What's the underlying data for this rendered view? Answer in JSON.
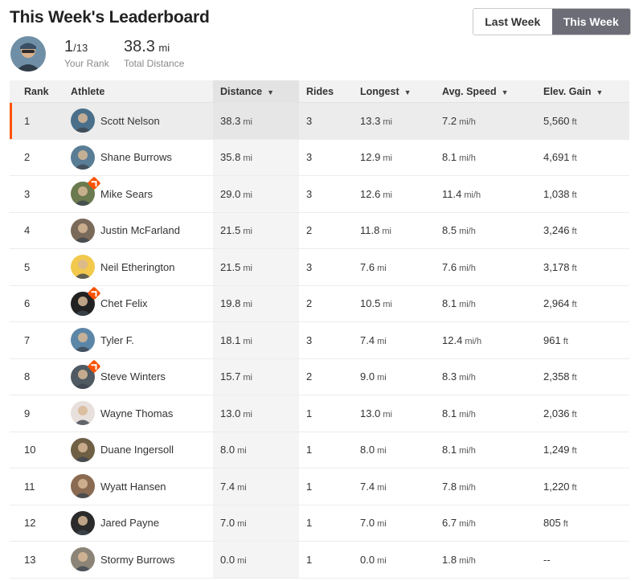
{
  "header": {
    "title": "This Week's Leaderboard",
    "toggle": {
      "last_week": "Last Week",
      "this_week": "This Week",
      "selected": "This Week"
    },
    "stats": {
      "rank_value": "1",
      "rank_total": "/13",
      "rank_label": "Your Rank",
      "distance_value": "38.3",
      "distance_unit": "mi",
      "distance_label": "Total Distance"
    }
  },
  "table": {
    "columns": {
      "rank": "Rank",
      "athlete": "Athlete",
      "distance": "Distance",
      "rides": "Rides",
      "longest": "Longest",
      "speed": "Avg. Speed",
      "elev": "Elev. Gain"
    },
    "sort_icon": "caret-down-icon",
    "rows": [
      {
        "rank": "1",
        "name": "Scott Nelson",
        "distance": "38.3",
        "rides": "3",
        "longest": "13.3",
        "speed": "7.2",
        "elev": "5,560",
        "dist_unit": "mi",
        "longest_unit": "mi",
        "speed_unit": "mi/h",
        "elev_unit": "ft",
        "badge": false,
        "avatar_color": "#4a6f8a"
      },
      {
        "rank": "2",
        "name": "Shane Burrows",
        "distance": "35.8",
        "rides": "3",
        "longest": "12.9",
        "speed": "8.1",
        "elev": "4,691",
        "dist_unit": "mi",
        "longest_unit": "mi",
        "speed_unit": "mi/h",
        "elev_unit": "ft",
        "badge": false,
        "avatar_color": "#5a7d96"
      },
      {
        "rank": "3",
        "name": "Mike Sears",
        "distance": "29.0",
        "rides": "3",
        "longest": "12.6",
        "speed": "11.4",
        "elev": "1,038",
        "dist_unit": "mi",
        "longest_unit": "mi",
        "speed_unit": "mi/h",
        "elev_unit": "ft",
        "badge": true,
        "avatar_color": "#6b7a4f"
      },
      {
        "rank": "4",
        "name": "Justin McFarland",
        "distance": "21.5",
        "rides": "2",
        "longest": "11.8",
        "speed": "8.5",
        "elev": "3,246",
        "dist_unit": "mi",
        "longest_unit": "mi",
        "speed_unit": "mi/h",
        "elev_unit": "ft",
        "badge": false,
        "avatar_color": "#7a6a5a"
      },
      {
        "rank": "5",
        "name": "Neil Etherington",
        "distance": "21.5",
        "rides": "3",
        "longest": "7.6",
        "speed": "7.6",
        "elev": "3,178",
        "dist_unit": "mi",
        "longest_unit": "mi",
        "speed_unit": "mi/h",
        "elev_unit": "ft",
        "badge": false,
        "avatar_color": "#f2c94c"
      },
      {
        "rank": "6",
        "name": "Chet Felix",
        "distance": "19.8",
        "rides": "2",
        "longest": "10.5",
        "speed": "8.1",
        "elev": "2,964",
        "dist_unit": "mi",
        "longest_unit": "mi",
        "speed_unit": "mi/h",
        "elev_unit": "ft",
        "badge": true,
        "avatar_color": "#222222"
      },
      {
        "rank": "7",
        "name": "Tyler F.",
        "distance": "18.1",
        "rides": "3",
        "longest": "7.4",
        "speed": "12.4",
        "elev": "961",
        "dist_unit": "mi",
        "longest_unit": "mi",
        "speed_unit": "mi/h",
        "elev_unit": "ft",
        "badge": false,
        "avatar_color": "#5b86a8"
      },
      {
        "rank": "8",
        "name": "Steve Winters",
        "distance": "15.7",
        "rides": "2",
        "longest": "9.0",
        "speed": "8.3",
        "elev": "2,358",
        "dist_unit": "mi",
        "longest_unit": "mi",
        "speed_unit": "mi/h",
        "elev_unit": "ft",
        "badge": true,
        "avatar_color": "#4f5a62"
      },
      {
        "rank": "9",
        "name": "Wayne Thomas",
        "distance": "13.0",
        "rides": "1",
        "longest": "13.0",
        "speed": "8.1",
        "elev": "2,036",
        "dist_unit": "mi",
        "longest_unit": "mi",
        "speed_unit": "mi/h",
        "elev_unit": "ft",
        "badge": false,
        "avatar_color": "#e8e0dc"
      },
      {
        "rank": "10",
        "name": "Duane Ingersoll",
        "distance": "8.0",
        "rides": "1",
        "longest": "8.0",
        "speed": "8.1",
        "elev": "1,249",
        "dist_unit": "mi",
        "longest_unit": "mi",
        "speed_unit": "mi/h",
        "elev_unit": "ft",
        "badge": false,
        "avatar_color": "#6e5f45"
      },
      {
        "rank": "11",
        "name": "Wyatt Hansen",
        "distance": "7.4",
        "rides": "1",
        "longest": "7.4",
        "speed": "7.8",
        "elev": "1,220",
        "dist_unit": "mi",
        "longest_unit": "mi",
        "speed_unit": "mi/h",
        "elev_unit": "ft",
        "badge": false,
        "avatar_color": "#8a6b52"
      },
      {
        "rank": "12",
        "name": "Jared Payne",
        "distance": "7.0",
        "rides": "1",
        "longest": "7.0",
        "speed": "6.7",
        "elev": "805",
        "dist_unit": "mi",
        "longest_unit": "mi",
        "speed_unit": "mi/h",
        "elev_unit": "ft",
        "badge": false,
        "avatar_color": "#2b2b2b"
      },
      {
        "rank": "13",
        "name": "Stormy Burrows",
        "distance": "0.0",
        "rides": "1",
        "longest": "0.0",
        "speed": "1.8",
        "elev": "--",
        "dist_unit": "mi",
        "longest_unit": "mi",
        "speed_unit": "mi/h",
        "elev_unit": "",
        "badge": false,
        "avatar_color": "#8c8577"
      }
    ],
    "current_athlete_rank": "1",
    "accent_color": "#fc5200"
  }
}
